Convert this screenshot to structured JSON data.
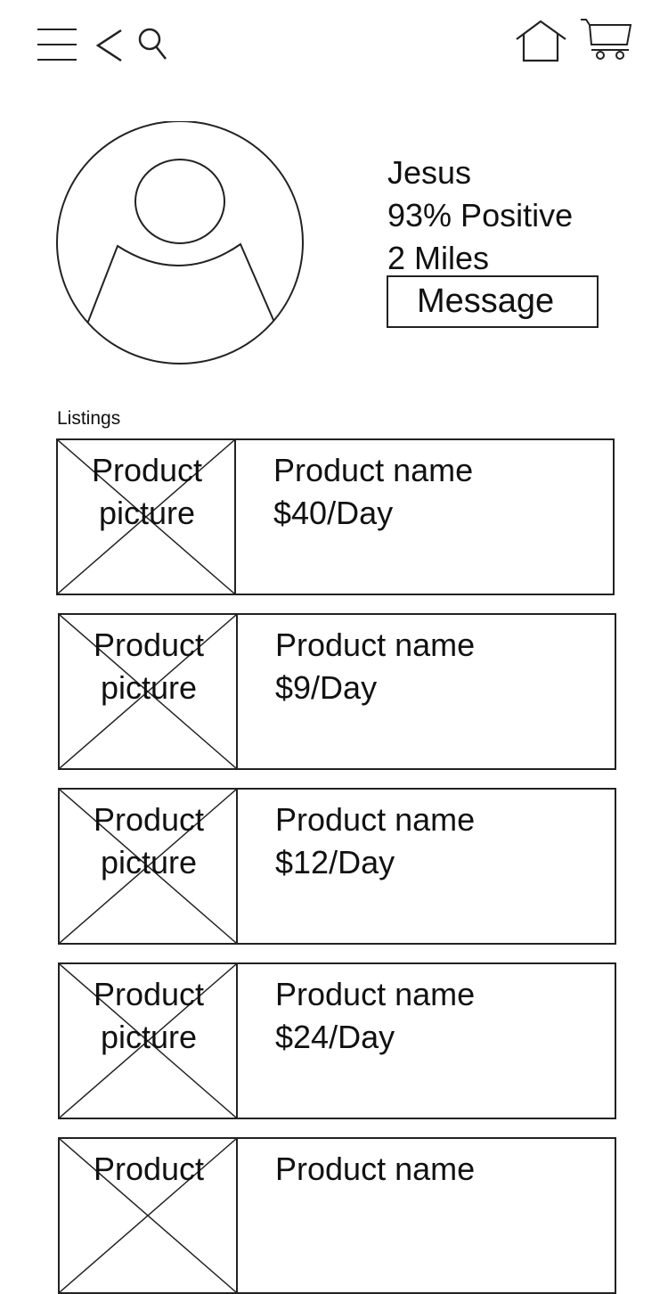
{
  "nav": {
    "menu_icon": "hamburger-icon",
    "back_icon": "chevron-left-icon",
    "search_icon": "search-icon",
    "home_icon": "home-icon",
    "cart_icon": "cart-icon"
  },
  "profile": {
    "name": "Jesus",
    "rating": "93% Positive",
    "distance": "2 Miles",
    "message_label": "Message"
  },
  "listings": {
    "label": "Listings",
    "items": [
      {
        "picture_line1": "Product",
        "picture_line2": "picture",
        "name": "Product name",
        "price": "$40/Day"
      },
      {
        "picture_line1": "Product",
        "picture_line2": "picture",
        "name": "Product name",
        "price": "$9/Day"
      },
      {
        "picture_line1": "Product",
        "picture_line2": "picture",
        "name": "Product name",
        "price": "$12/Day"
      },
      {
        "picture_line1": "Product",
        "picture_line2": "picture",
        "name": "Product name",
        "price": "$24/Day"
      },
      {
        "picture_line1": "Product",
        "picture_line2": "",
        "name": "Product name",
        "price": ""
      }
    ]
  }
}
